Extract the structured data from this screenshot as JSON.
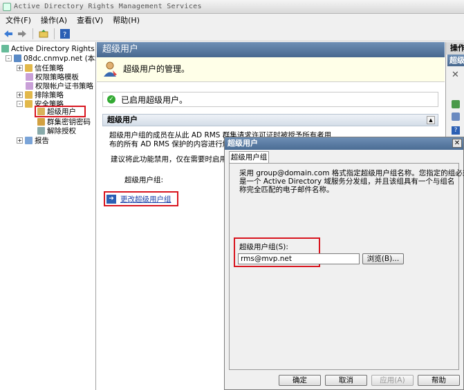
{
  "window": {
    "title": "Active Directory Rights Management Services"
  },
  "menu": [
    "文件(F)",
    "操作(A)",
    "查看(V)",
    "帮助(H)"
  ],
  "tree": {
    "root": "Active Directory Rights",
    "server": "08dc.cnmvp.net (本地",
    "items": [
      {
        "label": "信任策略",
        "expander": "+"
      },
      {
        "label": "权限策略模板",
        "expander": ""
      },
      {
        "label": "权限帐户证书策略",
        "expander": ""
      },
      {
        "label": "排除策略",
        "expander": "+"
      },
      {
        "label": "安全策略",
        "expander": "-"
      },
      {
        "label": "超级用户",
        "expander": "",
        "selected": true
      },
      {
        "label": "群集密钥密码",
        "expander": ""
      },
      {
        "label": "解除授权",
        "expander": ""
      },
      {
        "label": "报告",
        "expander": "+"
      }
    ]
  },
  "main": {
    "header": "超级用户",
    "description": "超级用户的管理。",
    "status": "已启用超级用户。",
    "section_title": "超级用户",
    "para1_line1": "超级用户组的成员在从此 AD RMS 群集请求许可证时被授予所有者用户访问权",
    "para1_line2": "布的所有 AD RMS 保护的内容进行解",
    "para2": "建议将此功能禁用，仅在需要时启用",
    "group_label": "超级用户组:",
    "change_link": "更改超级用户组"
  },
  "actions": {
    "header": "操作",
    "item": "超级"
  },
  "dialog": {
    "title": "超级用户",
    "tab": "超级用户组",
    "info_line1": "采用 group@domain.com 格式指定超级用户组名称。您指定的组必须",
    "info_line2": "是一个 Active Directory 域服务分发组，并且该组具有一个与组名",
    "info_line3": "称完全匹配的电子邮件名称。",
    "field_label": "超级用户组(S):",
    "field_value": "rms@mvp.net",
    "browse": "浏览(B)...",
    "ok": "确定",
    "cancel": "取消",
    "apply": "应用(A)",
    "help": "帮助"
  }
}
